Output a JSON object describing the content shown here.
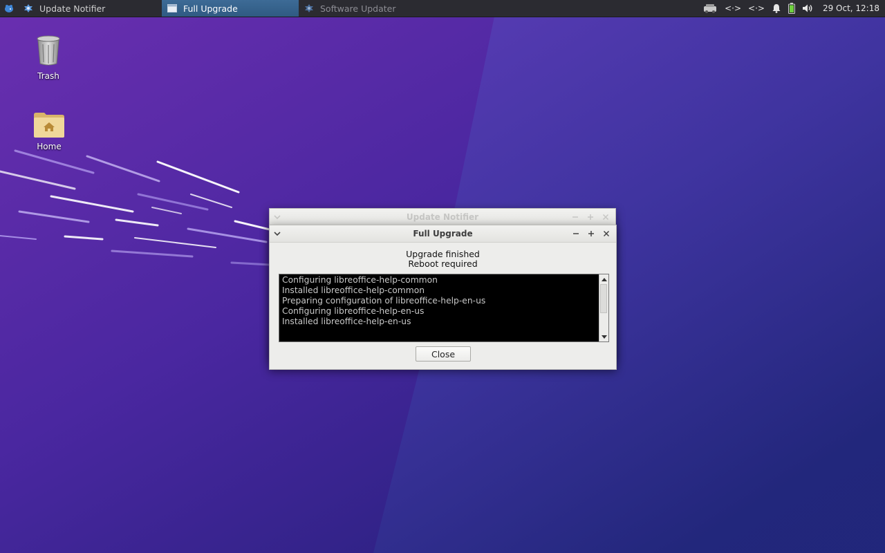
{
  "panel": {
    "tasks": [
      {
        "label": "Update Notifier",
        "icon": "updater-icon",
        "state": "normal"
      },
      {
        "label": "Full Upgrade",
        "icon": "window-icon",
        "state": "active"
      },
      {
        "label": "Software Updater",
        "icon": "updater-icon",
        "state": "dimmed"
      }
    ],
    "tray": {
      "network_label": "<·>",
      "network2_label": "<·>",
      "clock": "29 Oct, 12:18"
    }
  },
  "desktop": {
    "icons": [
      {
        "label": "Trash",
        "icon": "trash-icon"
      },
      {
        "label": "Home",
        "icon": "home-folder-icon"
      }
    ]
  },
  "background_window": {
    "title": "Update Notifier"
  },
  "dialog": {
    "title": "Full Upgrade",
    "status_line1": "Upgrade finished",
    "status_line2": "Reboot required",
    "log_lines": [
      "Configuring libreoffice-help-common",
      "Installed libreoffice-help-common",
      "Preparing configuration of libreoffice-help-en-us",
      "Configuring libreoffice-help-en-us",
      "Installed libreoffice-help-en-us"
    ],
    "close_label": "Close"
  },
  "colors": {
    "panel_bg": "#2b2b31",
    "active_task": "#3d6b96",
    "wallpaper": "#3a2590",
    "terminal_bg": "#000000",
    "terminal_text": "#c8c8c8"
  }
}
